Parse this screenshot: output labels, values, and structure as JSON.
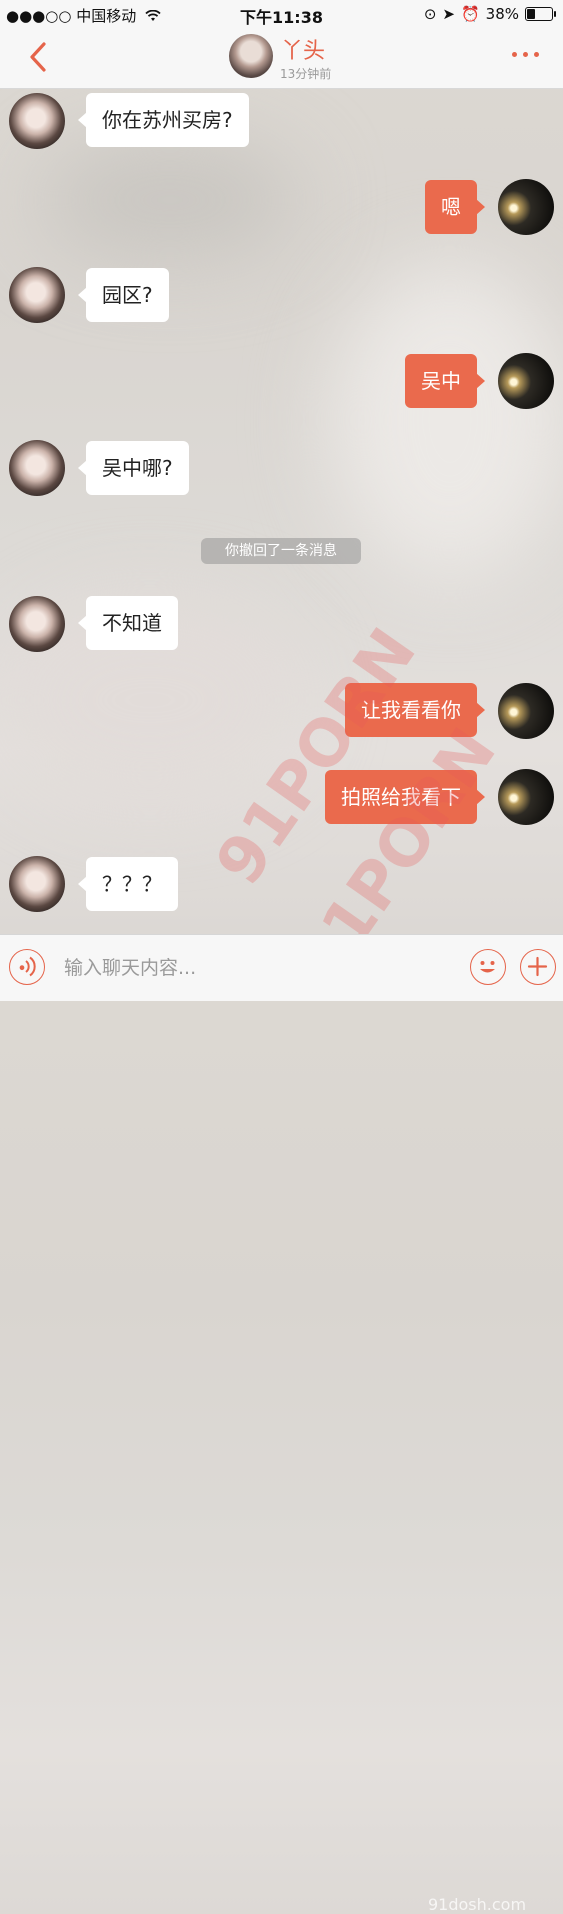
{
  "status_bar": {
    "carrier": "●●●○○ 中国移动",
    "time": "下午11:38",
    "battery_percent": "38%",
    "battery_level": 0.38
  },
  "nav": {
    "contact_name": "丫头",
    "last_seen": "13分钟前"
  },
  "messages": [
    {
      "from": "her",
      "text": "你在苏州买房?"
    },
    {
      "from": "me",
      "text": "嗯"
    },
    {
      "from": "her",
      "text": "园区?"
    },
    {
      "from": "me",
      "text": "吴中"
    },
    {
      "from": "her",
      "text": "吴中哪?"
    },
    {
      "from": "system",
      "text": "你撤回了一条消息"
    },
    {
      "from": "her",
      "text": "不知道"
    },
    {
      "from": "me",
      "text": "让我看看你"
    },
    {
      "from": "me",
      "text": "拍照给我看下"
    },
    {
      "from": "her",
      "text": "？？？"
    }
  ],
  "input_bar": {
    "placeholder": "输入聊天内容..."
  },
  "watermark": {
    "text": "91PORN",
    "site": "91dosh.com"
  },
  "colors": {
    "accent": "#e5644a",
    "outgoing_bubble": "#ea6a4d",
    "incoming_bubble": "#ffffff"
  }
}
